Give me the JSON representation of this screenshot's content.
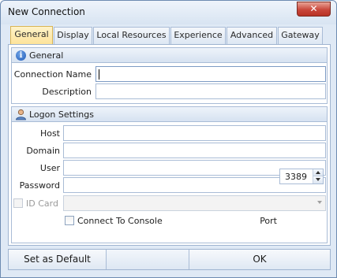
{
  "window": {
    "title": "New Connection",
    "close_label": "✕"
  },
  "tabs": [
    {
      "label": "General",
      "active": true
    },
    {
      "label": "Display"
    },
    {
      "label": "Local Resources"
    },
    {
      "label": "Experience"
    },
    {
      "label": "Advanced"
    },
    {
      "label": "Gateway"
    }
  ],
  "general": {
    "header": "General",
    "connection_name": {
      "label": "Connection Name",
      "value": ""
    },
    "description": {
      "label": "Description",
      "value": ""
    }
  },
  "logon": {
    "header": "Logon Settings",
    "host": {
      "label": "Host",
      "value": ""
    },
    "domain": {
      "label": "Domain",
      "value": ""
    },
    "user": {
      "label": "User",
      "value": ""
    },
    "password": {
      "label": "Password",
      "value": ""
    },
    "id_card": {
      "label": "ID Card",
      "checked": false,
      "enabled": false,
      "value": ""
    },
    "connect_console": {
      "label": "Connect To Console",
      "checked": false
    },
    "port": {
      "label": "Port",
      "value": "3389"
    }
  },
  "buttons": {
    "set_default": "Set as Default",
    "ok": "OK"
  },
  "colors": {
    "accent_tab": "#fde39a",
    "border": "#a9bcd6",
    "close": "#c9473b"
  }
}
